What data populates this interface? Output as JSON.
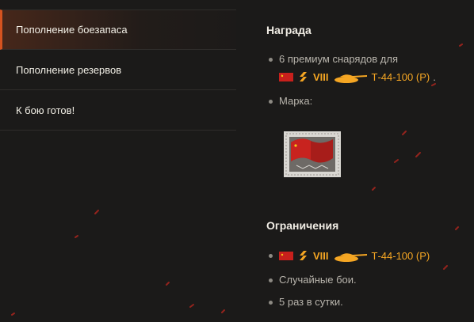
{
  "sidebar": {
    "items": [
      {
        "label": "Пополнение боезапаса",
        "active": true
      },
      {
        "label": "Пополнение резервов",
        "active": false
      },
      {
        "label": "К бою готов!",
        "active": false
      }
    ]
  },
  "reward": {
    "title": "Награда",
    "ammo_text": "6 премиум снарядов для",
    "vehicle": {
      "flag": "ussr-flag-icon",
      "tier": "VIII",
      "name": "Т-44-100 (Р)"
    },
    "trailing": ".",
    "stamp_label": "Марка:"
  },
  "restrictions": {
    "title": "Ограничения",
    "vehicle": {
      "flag": "ussr-flag-icon",
      "tier": "VIII",
      "name": "Т-44-100 (Р)"
    },
    "battles": "Случайные бои.",
    "limit": "5 раз в сутки."
  },
  "colors": {
    "accent": "#d5531f",
    "gold": "#f5a623",
    "background": "#1b1a19"
  }
}
